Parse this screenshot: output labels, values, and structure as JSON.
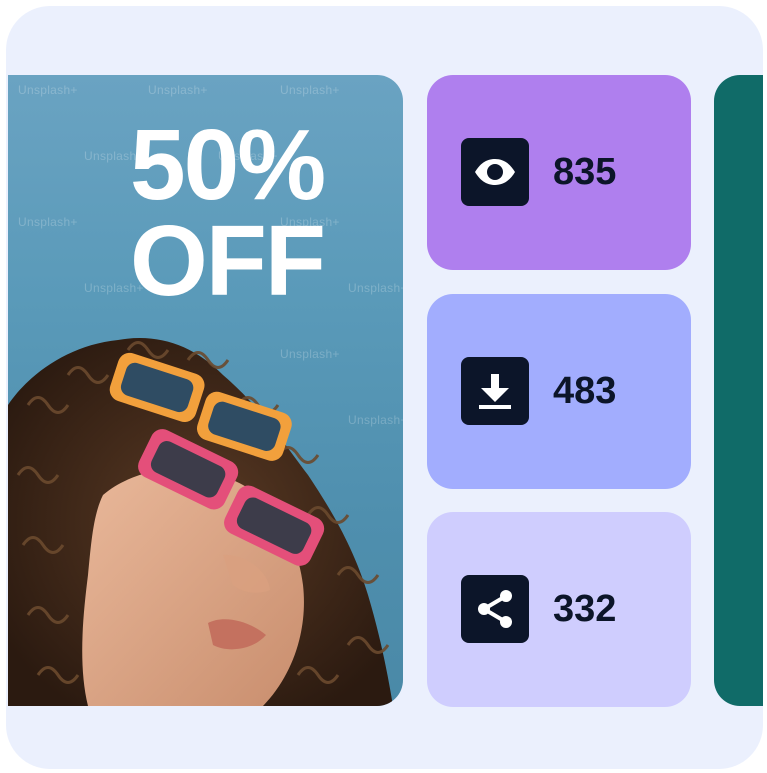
{
  "promo": {
    "headline_line1": "50%",
    "headline_line2": "OFF",
    "watermark": "Unsplash+",
    "image_description_icon": "person-with-sunglasses-photo"
  },
  "stats": [
    {
      "icon": "eye-icon",
      "value": "835",
      "color": "#af7fee"
    },
    {
      "icon": "download-icon",
      "value": "483",
      "color": "#a2adfe"
    },
    {
      "icon": "share-icon",
      "value": "332",
      "color": "#cfcdfe"
    }
  ],
  "colors": {
    "background": "#ebf0fd",
    "icon_box": "#0c1529",
    "side_panel": "#106b68"
  }
}
